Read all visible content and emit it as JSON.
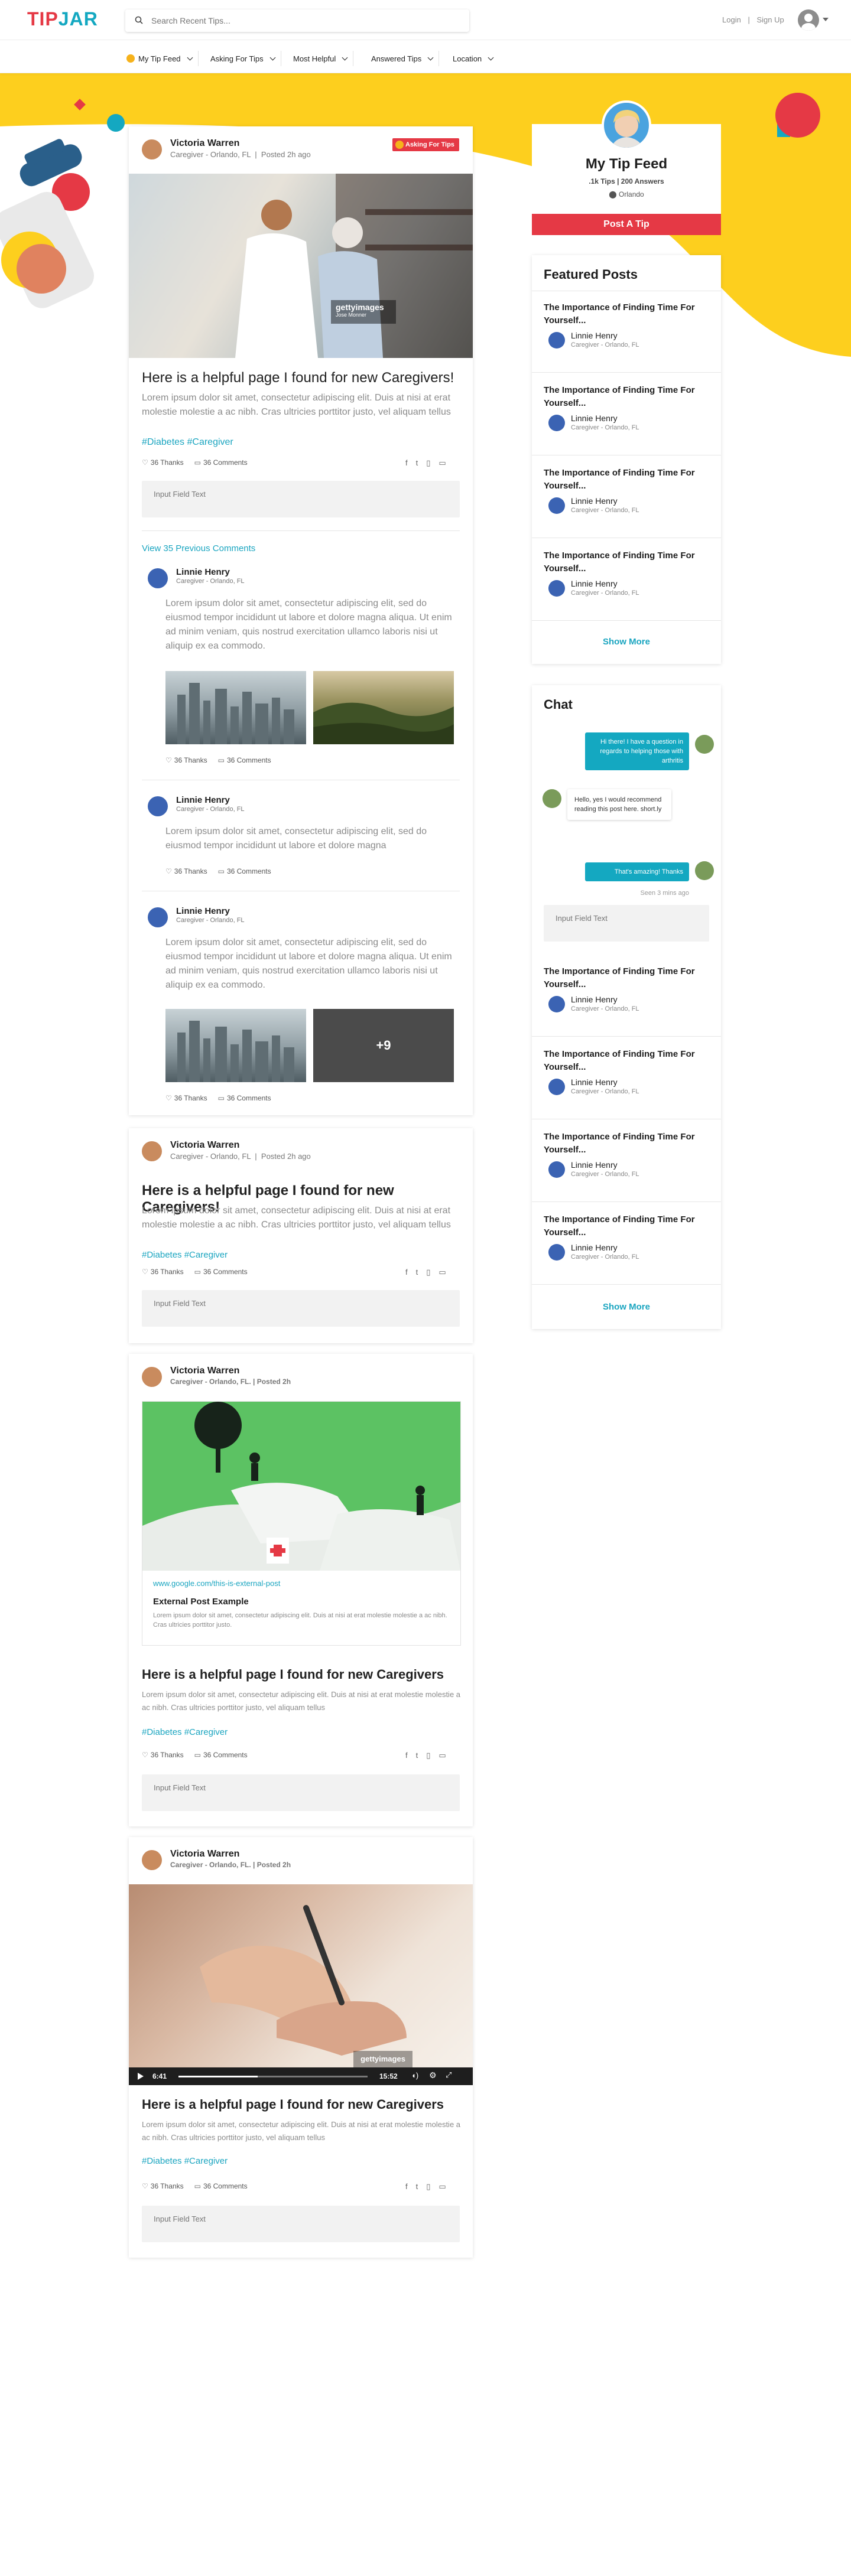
{
  "brand": {
    "tip": "TIP",
    "jar": "JAR"
  },
  "search": {
    "placeholder": "Search Recent Tips..."
  },
  "auth": {
    "login": "Login",
    "sep": "|",
    "signup": "Sign Up"
  },
  "filters": [
    {
      "label": "My Tip Feed"
    },
    {
      "label": "Asking For Tips"
    },
    {
      "label": "Most Helpful"
    },
    {
      "label": "Answered Tips"
    },
    {
      "label": "Location"
    }
  ],
  "profile": {
    "title": "My Tip Feed",
    "stats": ".1k Tips | 200 Answers",
    "location": "Orlando",
    "post_button": "Post A Tip"
  },
  "featured": {
    "heading": "Featured Posts",
    "items": [
      {
        "title": "The Importance of Finding Time For Yourself...",
        "name": "Linnie Henry",
        "sub": "Caregiver - Orlando, FL"
      },
      {
        "title": "The Importance of Finding Time For Yourself...",
        "name": "Linnie Henry",
        "sub": "Caregiver - Orlando, FL"
      },
      {
        "title": "The Importance of Finding Time For Yourself...",
        "name": "Linnie Henry",
        "sub": "Caregiver - Orlando, FL"
      },
      {
        "title": "The Importance of Finding Time For Yourself...",
        "name": "Linnie Henry",
        "sub": "Caregiver - Orlando, FL"
      }
    ],
    "show_more": "Show More"
  },
  "chat": {
    "heading": "Chat",
    "msg1": "Hi there! I have a question in regards to helping those with arthritis",
    "msg2": "Hello, yes I would recommend reading this post here. short.ly",
    "msg3": "That's amazing! Thanks",
    "seen": "Seen 3 mins ago",
    "input_placeholder": "Input Field Text",
    "items": [
      {
        "title": "The Importance of Finding Time For Yourself...",
        "name": "Linnie Henry",
        "sub": "Caregiver - Orlando, FL"
      },
      {
        "title": "The Importance of Finding Time For Yourself...",
        "name": "Linnie Henry",
        "sub": "Caregiver - Orlando, FL"
      },
      {
        "title": "The Importance of Finding Time For Yourself...",
        "name": "Linnie Henry",
        "sub": "Caregiver - Orlando, FL"
      },
      {
        "title": "The Importance of Finding Time For Yourself...",
        "name": "Linnie Henry",
        "sub": "Caregiver - Orlando, FL"
      }
    ],
    "show_more": "Show More"
  },
  "post1": {
    "author": "Victoria Warren",
    "sub": "Caregiver - Orlando, FL",
    "posted": "Posted 2h ago",
    "badge": "Asking For Tips",
    "watermark": "gettyimages",
    "watermark_credit": "Jose Monner",
    "title": "Here is a helpful page I found for new Caregivers!",
    "body": "Lorem ipsum dolor sit amet, consectetur adipiscing elit. Duis at nisi at erat molestie molestie a ac nibh. Cras ultricies porttitor justo, vel aliquam tellus",
    "tags": "#Diabetes #Caregiver",
    "thanks": "36 Thanks",
    "comments": "36 Comments",
    "input_placeholder": "Input Field Text",
    "view_previous": "View 35 Previous Comments",
    "replies": [
      {
        "name": "Linnie Henry",
        "sub": "Caregiver - Orlando, FL",
        "text": "Lorem ipsum dolor sit amet, consectetur adipiscing elit, sed do eiusmod tempor incididunt ut labore et dolore magna aliqua. Ut enim ad minim veniam, quis nostrud exercitation ullamco laboris nisi ut aliquip ex ea commodo.",
        "thanks": "36 Thanks",
        "comments": "36 Comments"
      },
      {
        "name": "Linnie Henry",
        "sub": "Caregiver - Orlando, FL",
        "text": "Lorem ipsum dolor sit amet, consectetur adipiscing elit, sed do eiusmod tempor incididunt ut labore et dolore magna",
        "thanks": "36 Thanks",
        "comments": "36 Comments"
      },
      {
        "name": "Linnie Henry",
        "sub": "Caregiver - Orlando, FL",
        "text": "Lorem ipsum dolor sit amet, consectetur adipiscing elit, sed do eiusmod tempor incididunt ut labore et dolore magna aliqua. Ut enim ad minim veniam, quis nostrud exercitation ullamco laboris nisi ut aliquip ex ea commodo.",
        "thanks": "36 Thanks",
        "comments": "36 Comments",
        "more": "+9"
      }
    ]
  },
  "post2": {
    "author": "Victoria Warren",
    "sub": "Caregiver - Orlando, FL",
    "posted": "Posted 2h ago",
    "title": "Here is a helpful page I found for new Caregivers!",
    "body": "Lorem ipsum dolor sit amet, consectetur adipiscing elit. Duis at nisi at erat molestie molestie a ac nibh. Cras ultricies porttitor justo, vel aliquam tellus",
    "tags": "#Diabetes  #Caregiver",
    "thanks": "36 Thanks",
    "comments": "36 Comments",
    "input_placeholder": "Input Field Text"
  },
  "post3": {
    "author": "Victoria Warren",
    "sub": "Caregiver - Orlando, FL. | Posted 2h",
    "link_url": "www.google.com/this-is-external-post",
    "link_title": "External Post Example",
    "link_desc": "Lorem ipsum dolor sit amet, consectetur adipiscing elit. Duis at nisi at erat molestie molestie a ac nibh. Cras ultricies porttitor justo.",
    "title": "Here is a helpful page I found for new Caregivers",
    "body": "Lorem ipsum dolor sit amet, consectetur adipiscing elit. Duis at nisi at erat molestie molestie a ac nibh. Cras ultricies porttitor justo, vel aliquam tellus",
    "tags": "#Diabetes  #Caregiver",
    "thanks": "36 Thanks",
    "comments": "36 Comments",
    "input_placeholder": "Input Field Text"
  },
  "post4": {
    "author": "Victoria Warren",
    "sub": "Caregiver - Orlando, FL. | Posted 2h",
    "watermark": "gettyimages",
    "time_current": "6:41",
    "time_total": "15:52",
    "progress": 0.42,
    "title": "Here is a helpful page I found for new Caregivers",
    "body": "Lorem ipsum dolor sit amet, consectetur adipiscing elit. Duis at nisi at erat molestie molestie a ac nibh. Cras ultricies porttitor justo, vel aliquam tellus",
    "tags": "#Diabetes  #Caregiver",
    "thanks": "36 Thanks",
    "comments": "36 Comments",
    "input_placeholder": "Input Field Text"
  },
  "colors": {
    "brand_red": "#e53945",
    "brand_teal": "#14a8c1",
    "yellow": "#fdcf1e"
  }
}
